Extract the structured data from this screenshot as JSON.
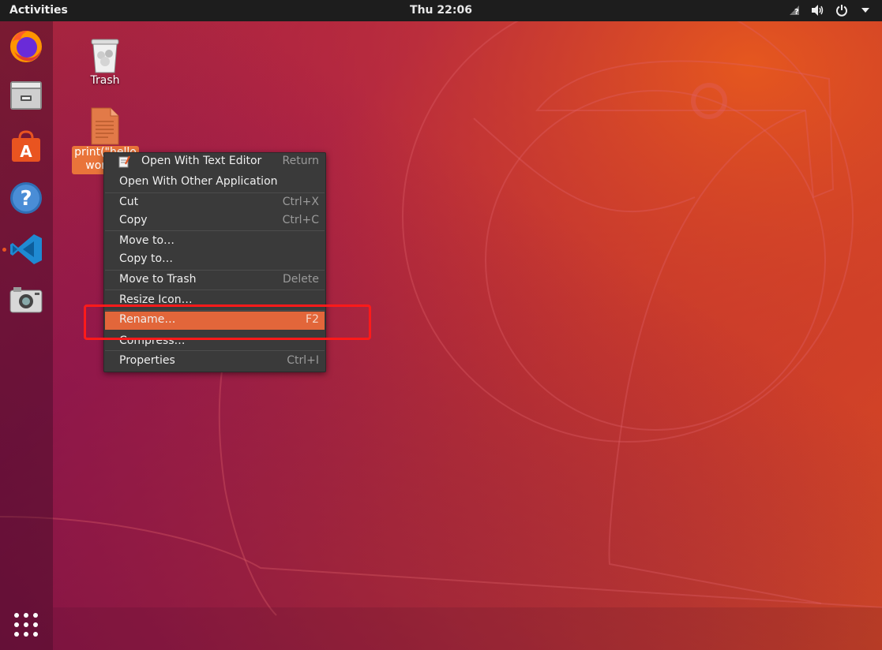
{
  "topbar": {
    "activities": "Activities",
    "clock": "Thu 22:06"
  },
  "tray": {
    "icons": [
      "network-question-icon",
      "volume-icon",
      "power-icon",
      "dropdown-arrow-icon"
    ]
  },
  "dock": {
    "items": [
      {
        "name": "firefox-icon"
      },
      {
        "name": "files-icon"
      },
      {
        "name": "software-icon"
      },
      {
        "name": "help-icon"
      },
      {
        "name": "vscode-icon"
      },
      {
        "name": "screenshot-camera-icon"
      }
    ],
    "show_apps_icon": "apps-grid-icon"
  },
  "desktop": {
    "trash_label": "Trash",
    "file_label": "print(\"hello world\")"
  },
  "context_menu": {
    "items": [
      {
        "label": "Open With Text Editor",
        "accel": "Return"
      },
      {
        "label": "Open With Other Application",
        "accel": ""
      },
      {
        "label": "Cut",
        "accel": "Ctrl+X"
      },
      {
        "label": "Copy",
        "accel": "Ctrl+C"
      },
      {
        "label": "Move to…",
        "accel": ""
      },
      {
        "label": "Copy to…",
        "accel": ""
      },
      {
        "label": "Move to Trash",
        "accel": "Delete"
      },
      {
        "label": "Resize Icon…",
        "accel": ""
      },
      {
        "label": "Rename…",
        "accel": "F2"
      },
      {
        "label": "Compress…",
        "accel": ""
      },
      {
        "label": "Properties",
        "accel": "Ctrl+I"
      }
    ],
    "active_item": "Rename…"
  },
  "colors": {
    "accent": "#e95420",
    "menu_bg": "#3a3a3a",
    "highlight": "#ff1a1a"
  }
}
